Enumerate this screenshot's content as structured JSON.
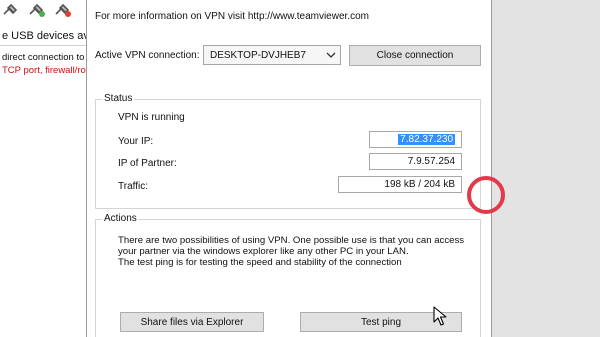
{
  "background_window": {
    "usb_text": "e USB devices ava",
    "line1": "direct connection to",
    "line2": "TCP port, firewall/ro",
    "toolbar_icons": [
      "usb-plug-icon",
      "usb-plug-icon",
      "usb-plug-icon"
    ]
  },
  "dialog": {
    "info_text": "For more information on VPN visit http://www.teamviewer.com",
    "active_vpn_label": "Active VPN connection:",
    "active_vpn_value": "DESKTOP-DVJHEB7",
    "close_connection_label": "Close connection",
    "status": {
      "title": "Status",
      "running_text": "VPN is running",
      "your_ip_label": "Your IP:",
      "your_ip_value": "7.82.37.230",
      "partner_ip_label": "IP of Partner:",
      "partner_ip_value": "7.9.57.254",
      "traffic_label": "Traffic:",
      "traffic_value": "198 kB / 204 kB"
    },
    "actions": {
      "title": "Actions",
      "description_line1": "There are two possibilities of using VPN. One possible use is that you can access",
      "description_line2": "your partner via the windows explorer like any other PC in your LAN.",
      "description_line3": "The test ping is for testing the speed and stability of the connection",
      "share_files_label": "Share files via Explorer",
      "test_ping_label": "Test ping"
    }
  },
  "colors": {
    "selection": "#3390ff",
    "annotation": "#e23a4a",
    "warning_text": "#d01010"
  }
}
